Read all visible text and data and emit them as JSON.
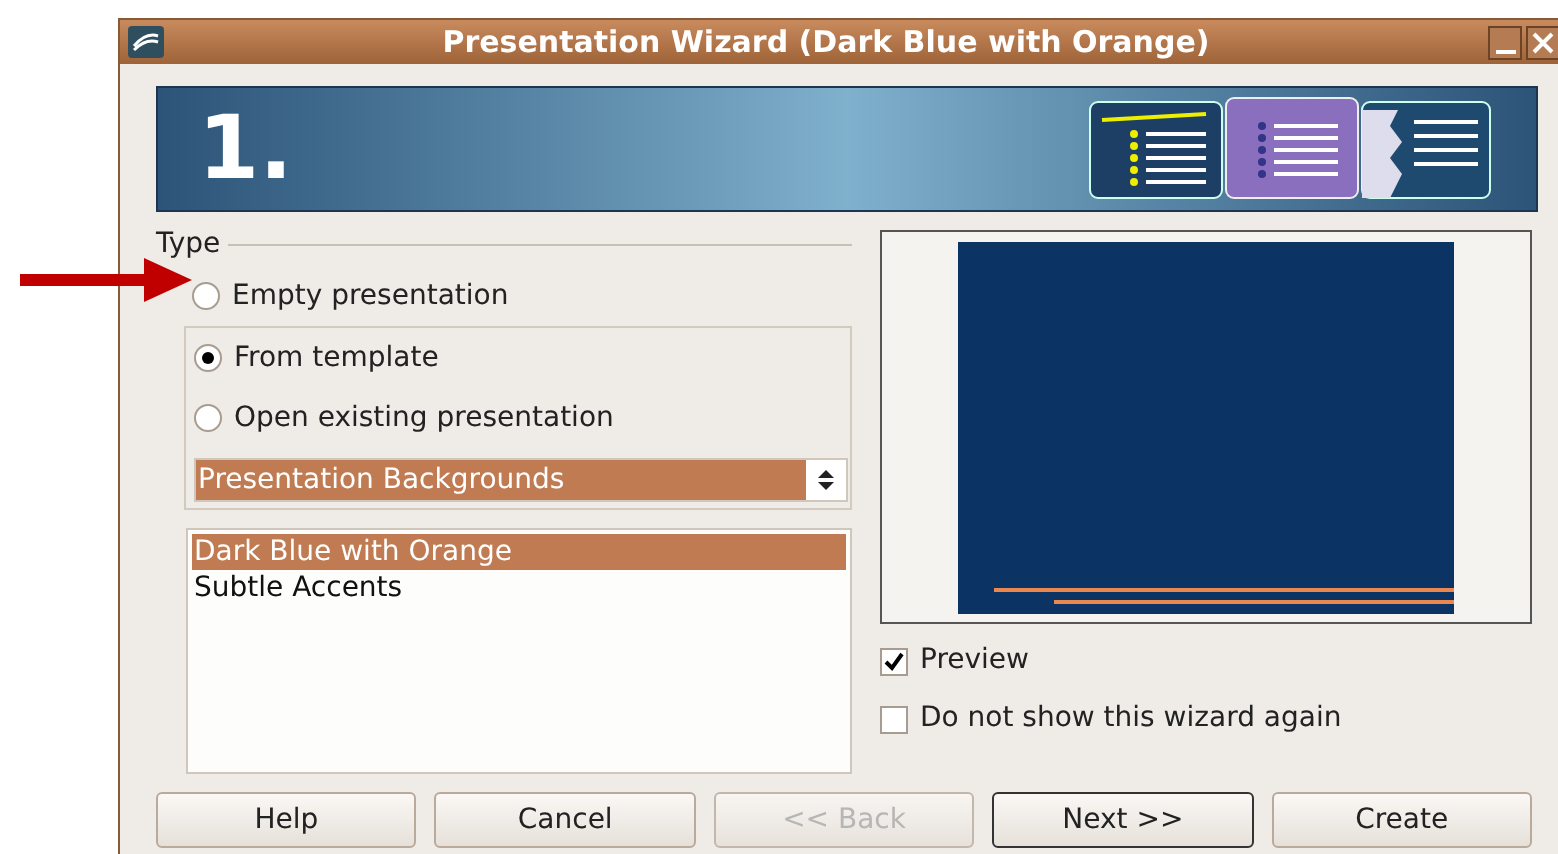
{
  "window": {
    "title": "Presentation Wizard (Dark Blue with Orange)"
  },
  "banner": {
    "step": "1."
  },
  "type_group": {
    "label": "Type",
    "options": [
      {
        "label": "Empty presentation",
        "selected": false
      },
      {
        "label": "From template",
        "selected": true
      },
      {
        "label": "Open existing presentation",
        "selected": false
      }
    ]
  },
  "template_category": {
    "value": "Presentation Backgrounds"
  },
  "templates": [
    {
      "label": "Dark Blue with Orange",
      "selected": true
    },
    {
      "label": "Subtle Accents",
      "selected": false
    }
  ],
  "options": [
    {
      "label": "Preview",
      "checked": true
    },
    {
      "label": "Do not show this wizard again",
      "checked": false
    }
  ],
  "buttons": [
    {
      "label": "Help",
      "disabled": false,
      "default": false
    },
    {
      "label": "Cancel",
      "disabled": false,
      "default": false
    },
    {
      "label": "<< Back",
      "disabled": true,
      "default": false
    },
    {
      "label": "Next >>",
      "disabled": false,
      "default": true
    },
    {
      "label": "Create",
      "disabled": false,
      "default": false
    }
  ]
}
